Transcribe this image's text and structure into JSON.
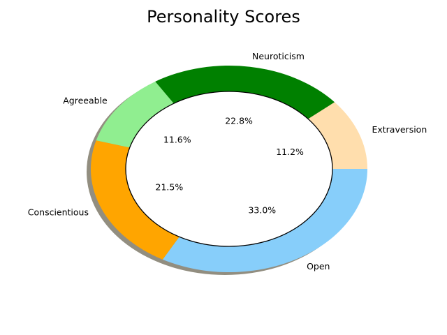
{
  "chart_data": {
    "type": "pie",
    "title": "Personality Scores",
    "donut": true,
    "shadow": true,
    "start_angle_deg": 0,
    "direction": "counterclockwise",
    "slices": [
      {
        "label": "Extraversion",
        "value": 11.2,
        "pct_label": "11.2%",
        "color": "#FFDEAD"
      },
      {
        "label": "Neuroticism",
        "value": 22.8,
        "pct_label": "22.8%",
        "color": "#008000"
      },
      {
        "label": "Agreeable",
        "value": 11.6,
        "pct_label": "11.6%",
        "color": "#90EE90"
      },
      {
        "label": "Conscientious",
        "value": 21.5,
        "pct_label": "21.5%",
        "color": "#FFA500"
      },
      {
        "label": "Open",
        "value": 33.0,
        "pct_label": "33.0%",
        "color": "#87CEFA"
      }
    ]
  }
}
